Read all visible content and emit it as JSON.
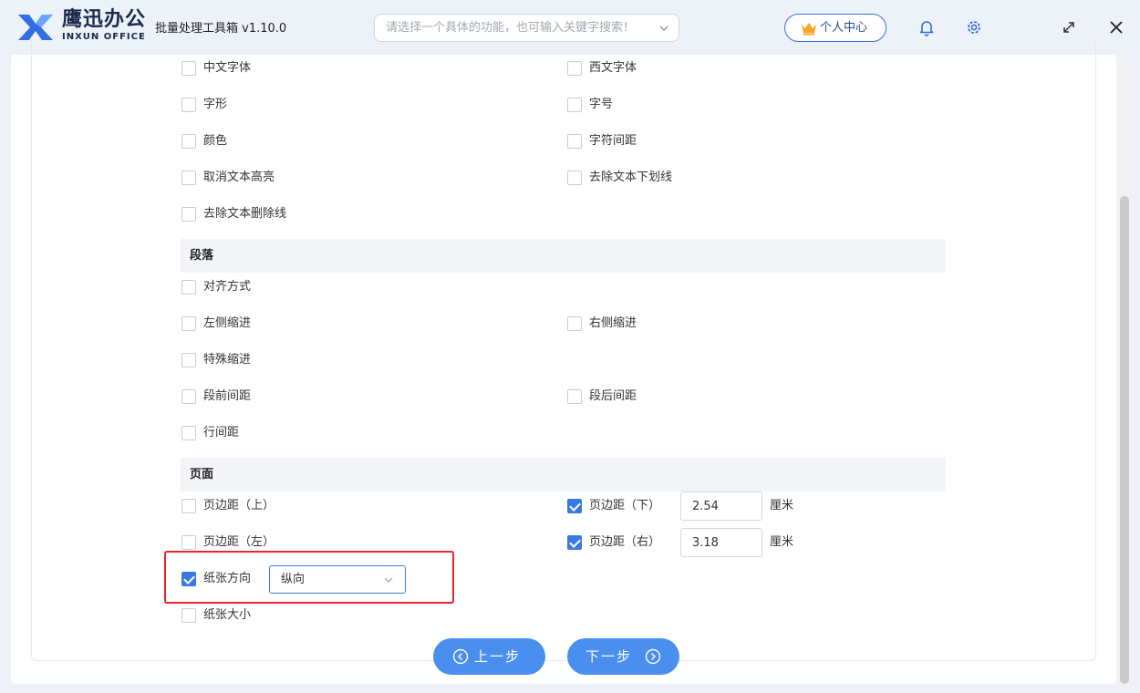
{
  "app": {
    "brand_cn": "鹰迅办公",
    "brand_en": "INXUN OFFICE",
    "title": "批量处理工具箱 v1.10.0",
    "search_placeholder": "请选择一个具体的功能，也可输入关键字搜索！",
    "user_center": "个人中心",
    "colors": {
      "accent": "#3a79e4",
      "highlight": "#e8262c",
      "button": "#4a8ff0"
    }
  },
  "font_options": [
    {
      "label": "中文字体",
      "checked": false
    },
    {
      "label": "西文字体",
      "checked": false
    },
    {
      "label": "字形",
      "checked": false
    },
    {
      "label": "字号",
      "checked": false
    },
    {
      "label": "颜色",
      "checked": false
    },
    {
      "label": "字符间距",
      "checked": false
    },
    {
      "label": "取消文本高亮",
      "checked": false
    },
    {
      "label": "去除文本下划线",
      "checked": false
    },
    {
      "label": "去除文本删除线",
      "checked": false
    }
  ],
  "paragraph": {
    "title": "段落",
    "options": [
      {
        "label": "对齐方式",
        "checked": false
      },
      {
        "label": "左侧缩进",
        "checked": false
      },
      {
        "label": "右侧缩进",
        "checked": false
      },
      {
        "label": "特殊缩进",
        "checked": false
      },
      {
        "label": "段前间距",
        "checked": false
      },
      {
        "label": "段后间距",
        "checked": false
      },
      {
        "label": "行间距",
        "checked": false
      }
    ]
  },
  "page": {
    "title": "页面",
    "margin_top": {
      "label": "页边距（上）",
      "checked": false
    },
    "margin_bottom": {
      "label": "页边距（下）",
      "checked": true,
      "value": "2.54",
      "unit": "厘米"
    },
    "margin_left": {
      "label": "页边距（左）",
      "checked": false
    },
    "margin_right": {
      "label": "页边距（右）",
      "checked": true,
      "value": "3.18",
      "unit": "厘米"
    },
    "orientation": {
      "label": "纸张方向",
      "checked": true,
      "value": "纵向"
    },
    "paper_size": {
      "label": "纸张大小",
      "checked": false
    }
  },
  "nav": {
    "prev": "上一步",
    "next": "下一步"
  }
}
